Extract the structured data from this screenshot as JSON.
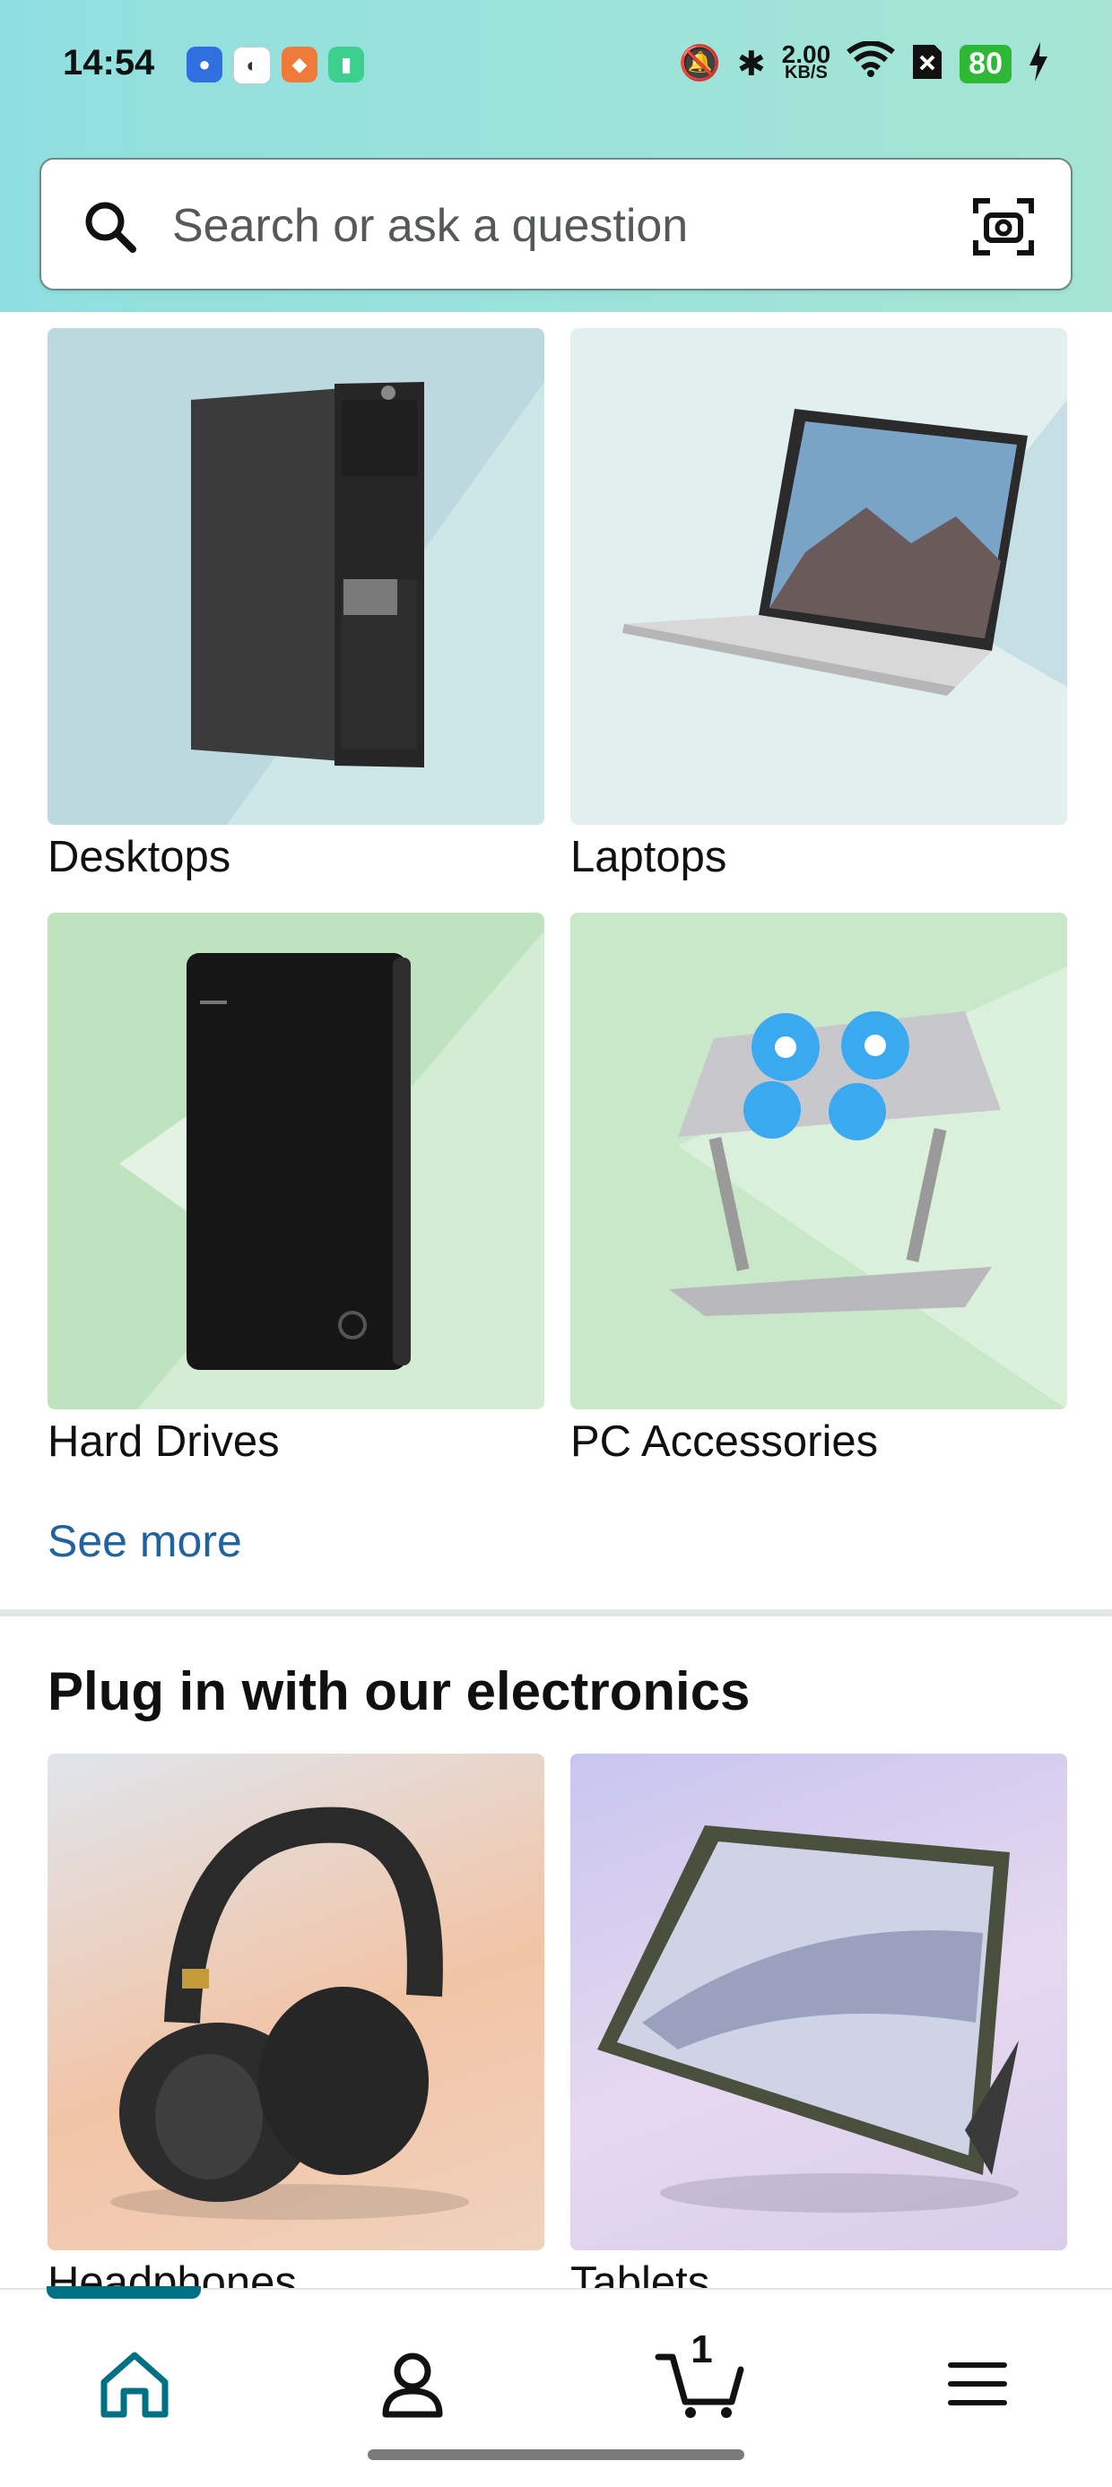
{
  "status_bar": {
    "time": "14:54",
    "network_speed_value": "2.00",
    "network_speed_unit": "KB/S",
    "battery": "80"
  },
  "search": {
    "placeholder": "Search or ask a question"
  },
  "categories": [
    {
      "label": "Desktops"
    },
    {
      "label": "Laptops"
    },
    {
      "label": "Hard Drives"
    },
    {
      "label": "PC Accessories"
    }
  ],
  "see_more": "See more",
  "electronics_section": {
    "title": "Plug in with our electronics",
    "items": [
      {
        "label": "Headphones"
      },
      {
        "label": "Tablets"
      }
    ]
  },
  "bottom_nav": {
    "cart_count": "1",
    "items": [
      "home",
      "account",
      "cart",
      "menu"
    ]
  },
  "colors": {
    "header_gradient_start": "#90dfe0",
    "header_gradient_end": "#a6e5d4",
    "link": "#2162a1",
    "active_nav": "#007185"
  }
}
